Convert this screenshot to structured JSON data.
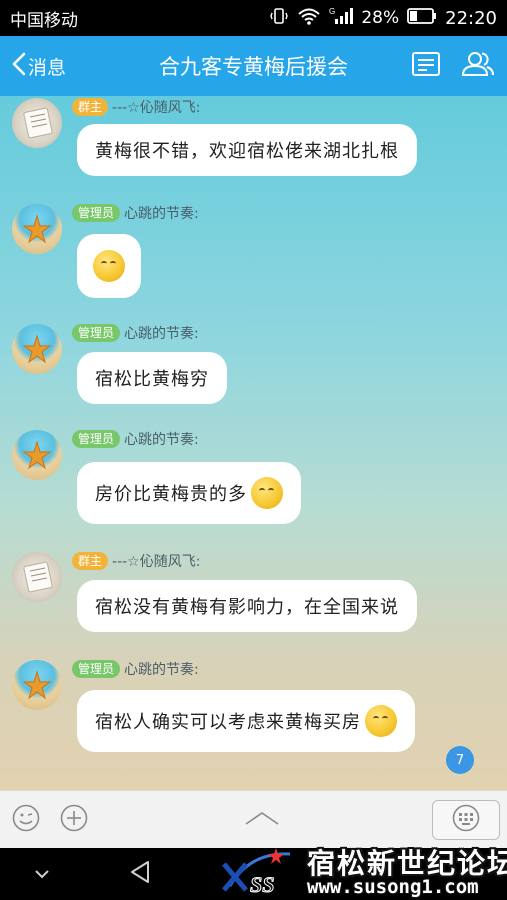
{
  "status_bar": {
    "carrier": "中国移动",
    "battery": "28%",
    "time": "22:20"
  },
  "header": {
    "back_label": "消息",
    "title": "合九客专黄梅后援会",
    "accent": "#26a6e8"
  },
  "messages": [
    {
      "avatar": "paper-avatar",
      "role_badge": "群主",
      "sender": "---☆伈随风飞:",
      "text": "黄梅很不错，欢迎宿松佬来湖北扎根",
      "emoji": false
    },
    {
      "avatar": "starfish-avatar",
      "role_badge": "管理员",
      "sender": "心跳的节奏:",
      "text": "",
      "emoji": true
    },
    {
      "avatar": "starfish-avatar",
      "role_badge": "管理员",
      "sender": "心跳的节奏:",
      "text": "宿松比黄梅穷",
      "emoji": false
    },
    {
      "avatar": "starfish-avatar",
      "role_badge": "管理员",
      "sender": "心跳的节奏:",
      "text": "房价比黄梅贵的多",
      "emoji": true
    },
    {
      "avatar": "paper-avatar",
      "role_badge": "群主",
      "sender": "---☆伈随风飞:",
      "text": "宿松没有黄梅有影响力，在全国来说",
      "emoji": false
    },
    {
      "avatar": "starfish-avatar",
      "role_badge": "管理员",
      "sender": "心跳的节奏:",
      "text": "宿松人确实可以考虑来黄梅买房",
      "emoji": true
    }
  ],
  "unread_count": "7",
  "watermark": {
    "logo_text": "SS",
    "title": "宿松新世纪论坛",
    "url": "www.susong1.com"
  }
}
